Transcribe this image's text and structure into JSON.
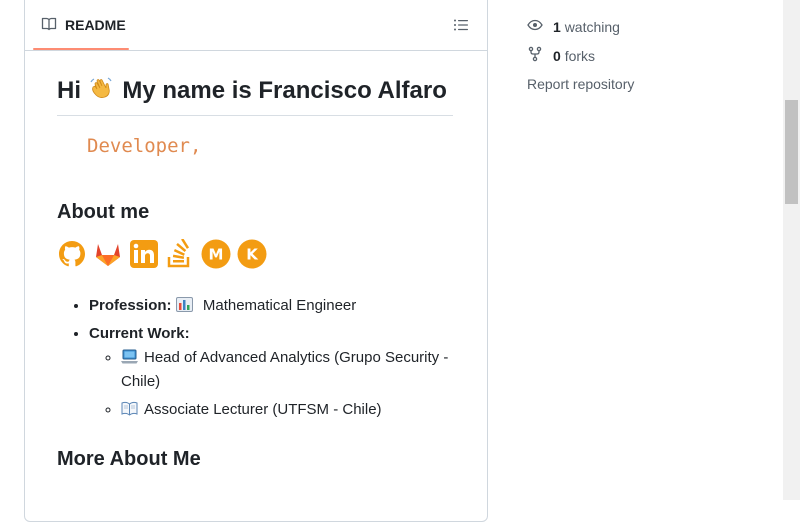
{
  "readme": {
    "tab_label": "README",
    "title_greeting": "Hi",
    "title_rest": "My name is Francisco Alfaro",
    "typing_text": "Developer,",
    "about_heading": "About me",
    "badges": [
      "github",
      "gitlab",
      "linkedin",
      "stackoverflow",
      "medium",
      "kaggle"
    ],
    "profession_label": "Profession:",
    "profession_value": "Mathematical Engineer",
    "current_work_label": "Current Work:",
    "work_items": [
      "Head of Advanced Analytics (Grupo Security - Chile)",
      "Associate Lecturer (UTFSM - Chile)"
    ],
    "more_heading": "More About Me"
  },
  "sidebar": {
    "watching_count": "1",
    "watching_label": "watching",
    "forks_count": "0",
    "forks_label": "forks",
    "report_label": "Report repository"
  },
  "colors": {
    "tab_underline": "#fd8c73",
    "typing_text": "#e08a50",
    "badge_orange": "#f39c12"
  }
}
